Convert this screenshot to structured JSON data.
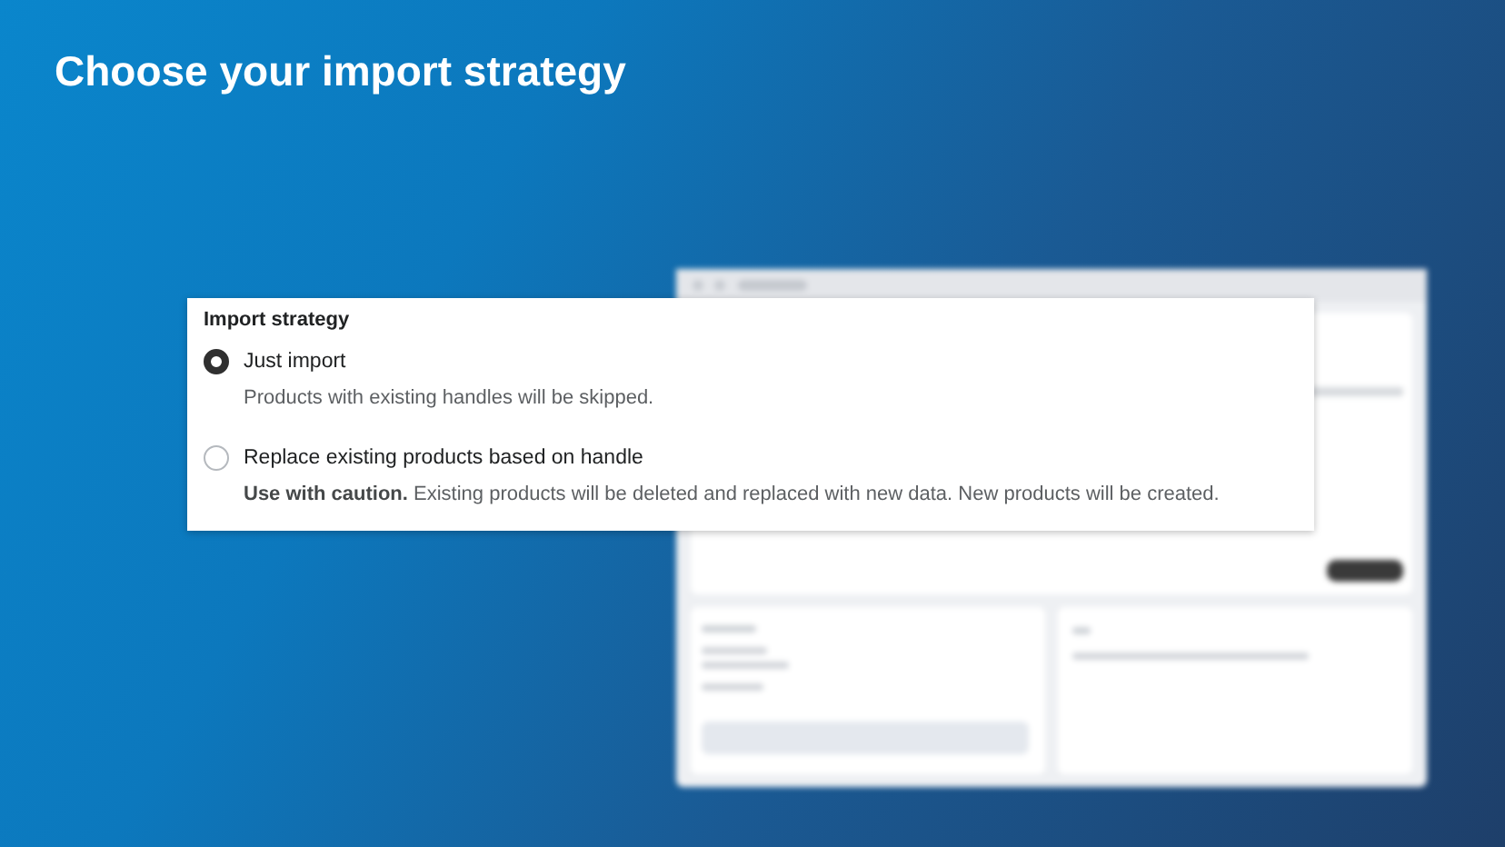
{
  "title": "Choose your import strategy",
  "panel": {
    "heading": "Import strategy",
    "options": [
      {
        "label": "Just import",
        "description": "Products with existing handles will be skipped.",
        "selected": true
      },
      {
        "label": "Replace existing products based on handle",
        "description": "**Use with caution.** Existing products will be deleted and replaced with new data. New products will be created.",
        "selected": false
      }
    ]
  }
}
